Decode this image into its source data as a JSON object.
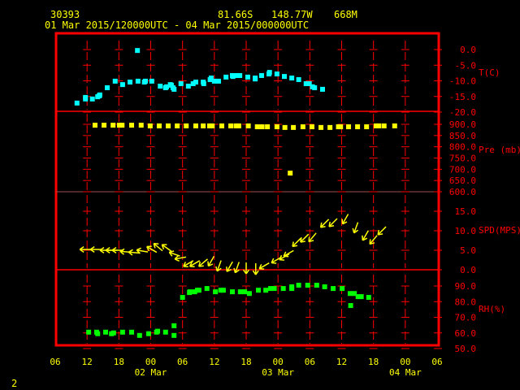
{
  "header": {
    "station": "30393",
    "lat": "81.66S",
    "lon": "148.77W",
    "elev": "668M",
    "period": "01 Mar 2015/120000UTC - 04 Mar 2015/000000UTC"
  },
  "page_number": "2",
  "colors": {
    "frame": "#ff0000",
    "text": "#ffff00",
    "temp": "#00ffff",
    "pres": "#ffff00",
    "wind": "#ffff00",
    "rh": "#00ff00"
  },
  "chart_data": {
    "type": "scatter",
    "x_axis": {
      "unit": "hours since 01 Mar 2015 00UTC",
      "range": [
        6,
        78
      ],
      "ticks": [
        6,
        12,
        18,
        24,
        30,
        36,
        42,
        48,
        54,
        60,
        66,
        72,
        78
      ],
      "tick_labels": [
        "06",
        "12",
        "18",
        "00",
        "06",
        "12",
        "18",
        "00",
        "06",
        "12",
        "18",
        "00",
        "06"
      ],
      "day_labels": [
        {
          "hour": 24,
          "label": "02 Mar"
        },
        {
          "hour": 48,
          "label": "03 Mar"
        },
        {
          "hour": 72,
          "label": "04 Mar"
        }
      ]
    },
    "panels": [
      {
        "id": "temp",
        "label": "T(C)",
        "range": [
          -20,
          0
        ],
        "ticks": [
          0,
          -5,
          -10,
          -15,
          -20
        ],
        "tick_labels": [
          "0.0",
          "-5.0",
          "-10.0",
          "-15.0",
          "-20.0"
        ],
        "points": [
          [
            10.1,
            -17.1
          ],
          [
            11.7,
            -15.3
          ],
          [
            11.7,
            -15.8
          ],
          [
            13.0,
            -15.8
          ],
          [
            14.0,
            -15.1
          ],
          [
            14.3,
            -14.8
          ],
          [
            14.4,
            -14.5
          ],
          [
            15.8,
            -12.2
          ],
          [
            17.3,
            -10.1
          ],
          [
            18.7,
            -11.2
          ],
          [
            20.1,
            -10.4
          ],
          [
            21.5,
            -0.3
          ],
          [
            21.6,
            -10.1
          ],
          [
            22.8,
            -10.4
          ],
          [
            23.0,
            -10.1
          ],
          [
            24.2,
            -10.1
          ],
          [
            25.8,
            -11.7
          ],
          [
            26.8,
            -12.2
          ],
          [
            27.0,
            -11.9
          ],
          [
            27.7,
            -11.2
          ],
          [
            27.9,
            -11.4
          ],
          [
            28.2,
            -12.2
          ],
          [
            28.4,
            -12.7
          ],
          [
            29.7,
            -10.9
          ],
          [
            31.1,
            -11.7
          ],
          [
            32.0,
            -10.9
          ],
          [
            32.5,
            -10.4
          ],
          [
            33.9,
            -10.4
          ],
          [
            34.0,
            -10.9
          ],
          [
            35.2,
            -9.6
          ],
          [
            35.4,
            -9.1
          ],
          [
            36.0,
            -10.1
          ],
          [
            36.8,
            -10.1
          ],
          [
            38.2,
            -8.8
          ],
          [
            39.4,
            -8.3
          ],
          [
            39.5,
            -8.6
          ],
          [
            40.3,
            -8.3
          ],
          [
            40.8,
            -8.3
          ],
          [
            42.3,
            -8.8
          ],
          [
            43.7,
            -9.1
          ],
          [
            43.7,
            -9.4
          ],
          [
            44.9,
            -8.3
          ],
          [
            46.3,
            -7.8
          ],
          [
            46.4,
            -7.3
          ],
          [
            47.8,
            -7.8
          ],
          [
            49.2,
            -8.6
          ],
          [
            50.6,
            -9.1
          ],
          [
            51.9,
            -9.6
          ],
          [
            53.3,
            -10.9
          ],
          [
            53.9,
            -10.9
          ],
          [
            54.5,
            -11.9
          ],
          [
            54.9,
            -12.2
          ],
          [
            56.4,
            -12.7
          ]
        ]
      },
      {
        "id": "pres",
        "label": "Pre (mb)",
        "range": [
          600,
          910
        ],
        "ticks": [
          900,
          850,
          800,
          750,
          700,
          650,
          600
        ],
        "tick_labels": [
          "900.0",
          "850.0",
          "800.0",
          "750.0",
          "700.0",
          "650.0",
          "600.0"
        ],
        "points": [
          [
            13.5,
            896
          ],
          [
            15.2,
            896
          ],
          [
            16.9,
            896
          ],
          [
            18.1,
            896
          ],
          [
            18.6,
            896
          ],
          [
            20.4,
            896
          ],
          [
            22.2,
            896
          ],
          [
            23.9,
            893
          ],
          [
            25.6,
            893
          ],
          [
            27.3,
            893
          ],
          [
            29.0,
            893
          ],
          [
            30.7,
            893
          ],
          [
            32.5,
            893
          ],
          [
            33.9,
            893
          ],
          [
            35.1,
            893
          ],
          [
            35.6,
            893
          ],
          [
            37.4,
            893
          ],
          [
            39.1,
            893
          ],
          [
            40.1,
            893
          ],
          [
            40.6,
            893
          ],
          [
            42.4,
            893
          ],
          [
            44.1,
            889
          ],
          [
            45.0,
            889
          ],
          [
            46.0,
            889
          ],
          [
            47.8,
            889
          ],
          [
            49.3,
            886
          ],
          [
            50.3,
            683
          ],
          [
            50.9,
            886
          ],
          [
            52.7,
            889
          ],
          [
            54.4,
            889
          ],
          [
            56.1,
            886
          ],
          [
            57.8,
            886
          ],
          [
            59.4,
            889
          ],
          [
            59.8,
            889
          ],
          [
            61.3,
            889
          ],
          [
            63.0,
            889
          ],
          [
            64.7,
            889
          ],
          [
            66.5,
            893
          ],
          [
            67.0,
            893
          ],
          [
            68.0,
            893
          ],
          [
            70.0,
            893
          ]
        ]
      },
      {
        "id": "wind",
        "label": "SPD(MPS)",
        "range": [
          0,
          16
        ],
        "ticks": [
          15,
          10,
          5,
          0
        ],
        "tick_labels": [
          "15.0",
          "10.0",
          "5.0",
          "0.0"
        ],
        "points_note": "[hour, speed m/s, direction from deg]",
        "points": [
          [
            11.7,
            5.2,
            90
          ],
          [
            13.7,
            5.2,
            90
          ],
          [
            15.5,
            5.0,
            90
          ],
          [
            16.6,
            5.0,
            90
          ],
          [
            17.8,
            5.0,
            90
          ],
          [
            19.3,
            4.6,
            95
          ],
          [
            20.9,
            4.4,
            95
          ],
          [
            22.4,
            4.8,
            100
          ],
          [
            24.2,
            5.2,
            120
          ],
          [
            25.4,
            5.8,
            130
          ],
          [
            27.0,
            5.6,
            125
          ],
          [
            28.5,
            4.0,
            110
          ],
          [
            29.6,
            3.0,
            80
          ],
          [
            31.1,
            1.6,
            60
          ],
          [
            32.3,
            1.6,
            60
          ],
          [
            33.9,
            1.8,
            50
          ],
          [
            35.4,
            2.2,
            30
          ],
          [
            36.9,
            1.0,
            20
          ],
          [
            38.9,
            0.8,
            30
          ],
          [
            40.3,
            0.6,
            20
          ],
          [
            42.0,
            0.4,
            0
          ],
          [
            43.8,
            0.2,
            0
          ],
          [
            45.4,
            1.0,
            60
          ],
          [
            47.7,
            2.5,
            60
          ],
          [
            49.2,
            3.3,
            60
          ],
          [
            50.0,
            4.2,
            60
          ],
          [
            51.5,
            7.0,
            45
          ],
          [
            53.0,
            8.1,
            45
          ],
          [
            54.5,
            8.3,
            40
          ],
          [
            56.8,
            11.9,
            45
          ],
          [
            58.4,
            12.1,
            45
          ],
          [
            60.7,
            13.0,
            30
          ],
          [
            62.7,
            10.8,
            20
          ],
          [
            64.5,
            8.8,
            30
          ],
          [
            66.0,
            7.7,
            40
          ],
          [
            67.6,
            10.0,
            45
          ]
        ]
      },
      {
        "id": "rh",
        "label": "RH(%)",
        "range": [
          50,
          100
        ],
        "ticks": [
          90,
          80,
          70,
          60,
          50
        ],
        "tick_labels": [
          "90.0",
          "80.0",
          "70.0",
          "60.0",
          "50.0"
        ],
        "points": [
          [
            12.3,
            60.5
          ],
          [
            13.8,
            60.5
          ],
          [
            14.0,
            59.5
          ],
          [
            15.5,
            60.5
          ],
          [
            16.6,
            59.5
          ],
          [
            17.0,
            60.0
          ],
          [
            18.7,
            60.5
          ],
          [
            20.4,
            60.5
          ],
          [
            21.9,
            58.4
          ],
          [
            23.6,
            59.5
          ],
          [
            25.1,
            60.5
          ],
          [
            25.3,
            61.1
          ],
          [
            26.8,
            60.5
          ],
          [
            28.4,
            58.4
          ],
          [
            28.4,
            64.6
          ],
          [
            30.0,
            82.7
          ],
          [
            31.3,
            85.8
          ],
          [
            31.4,
            86.3
          ],
          [
            32.3,
            86.3
          ],
          [
            32.8,
            87.3
          ],
          [
            33.1,
            87.3
          ],
          [
            34.6,
            88.4
          ],
          [
            36.2,
            86.3
          ],
          [
            37.2,
            87.3
          ],
          [
            37.7,
            87.3
          ],
          [
            39.4,
            86.3
          ],
          [
            40.9,
            86.3
          ],
          [
            41.7,
            86.3
          ],
          [
            42.6,
            85.2
          ],
          [
            44.3,
            87.3
          ],
          [
            45.7,
            87.3
          ],
          [
            46.6,
            88.4
          ],
          [
            47.3,
            88.4
          ],
          [
            49.0,
            88.4
          ],
          [
            50.6,
            88.4
          ],
          [
            50.6,
            89.5
          ],
          [
            51.9,
            90.5
          ],
          [
            53.6,
            90.5
          ],
          [
            55.3,
            90.5
          ],
          [
            56.8,
            89.5
          ],
          [
            58.4,
            88.4
          ],
          [
            60.1,
            88.4
          ],
          [
            61.6,
            85.2
          ],
          [
            61.7,
            77.5
          ],
          [
            62.4,
            85.2
          ],
          [
            63.1,
            83.2
          ],
          [
            63.7,
            83.2
          ],
          [
            65.1,
            82.7
          ]
        ]
      }
    ]
  }
}
